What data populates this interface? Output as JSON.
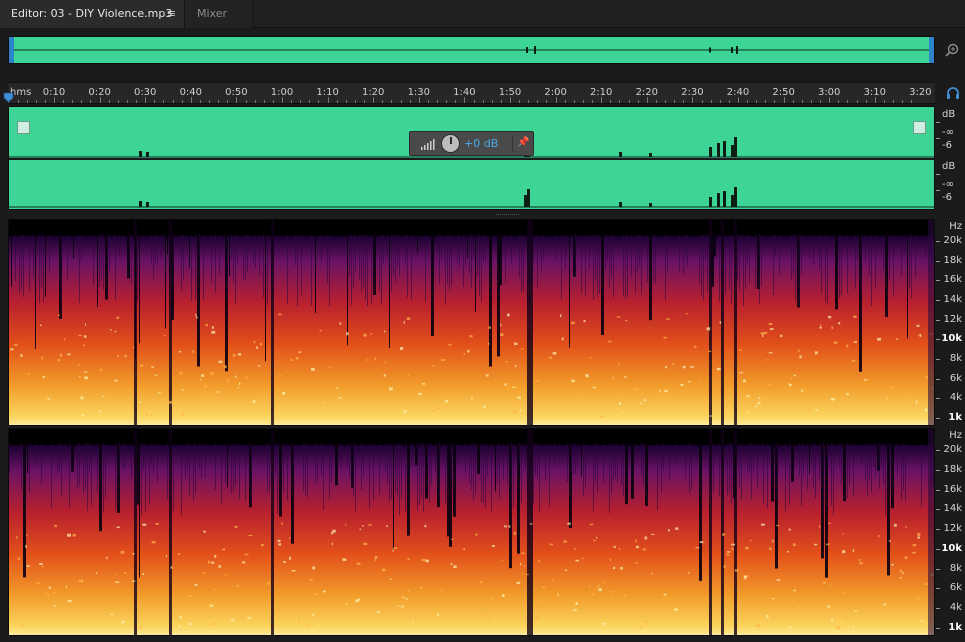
{
  "tabs": {
    "editor_label": "Editor: 03 - DIY Violence.mp3",
    "editor_menu_icon": "≡",
    "mixer_label": "Mixer"
  },
  "ruler": {
    "unit": "hms",
    "labels": [
      "0:10",
      "0:20",
      "0:30",
      "0:40",
      "0:50",
      "1:00",
      "1:10",
      "1:20",
      "1:30",
      "1:40",
      "1:50",
      "2:00",
      "2:10",
      "2:20",
      "2:30",
      "2:40",
      "2:50",
      "3:00",
      "3:10",
      "3:20"
    ]
  },
  "hud": {
    "volume": "+0 dB"
  },
  "waveform_scale": {
    "ch1": {
      "unit": "dB",
      "inf": "-∞",
      "six": "-6"
    },
    "ch2": {
      "unit": "dB",
      "inf": "-∞",
      "six": "-6"
    }
  },
  "spectral_scale": {
    "unit": "Hz",
    "labels": [
      "20k",
      "18k",
      "16k",
      "14k",
      "12k",
      "10k",
      "8k",
      "6k",
      "4k",
      "1k"
    ]
  },
  "colors": {
    "waveform": "#3dd596",
    "accent": "#2e84c9",
    "volume_text": "#49a9e8"
  },
  "icons": {
    "zoom": "zoom-icon",
    "headphones": "headphones-icon",
    "pin": "pin-icon"
  }
}
